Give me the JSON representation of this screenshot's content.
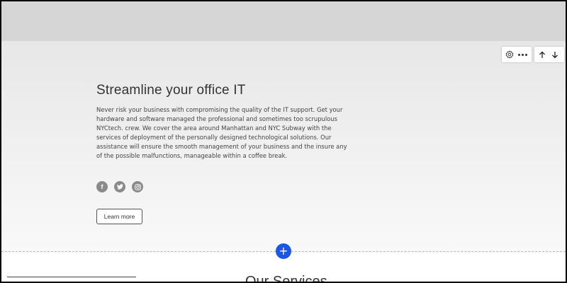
{
  "hero": {
    "title": "Streamline your office IT",
    "body": "Never risk your business with compromising the quality of the IT support. Get your hardware and software managed the professional and sometimes too scrupulous NYCtech. crew. We cover the area around Manhattan and NYC Subway with the services of deployment of the personally designed technological solutions. Our assistance will ensure the smooth management of your business and the insure any of the possible malfunctions, manageable within a coffee break.",
    "cta_label": "Learn more",
    "social_icons": [
      "facebook-icon",
      "twitter-icon",
      "instagram-icon"
    ],
    "social_glyphs": {
      "facebook": "f",
      "twitter": "t",
      "instagram": "◎"
    }
  },
  "toolbar": {
    "settings_icon": "gear-icon",
    "more_icon": "more-dots-icon",
    "move_up_icon": "arrow-up-icon",
    "move_down_icon": "arrow-down-icon"
  },
  "editor": {
    "add_section_glyph": "+",
    "add_section_color": "#1a56e8"
  },
  "next_section": {
    "title": "Our Services"
  }
}
